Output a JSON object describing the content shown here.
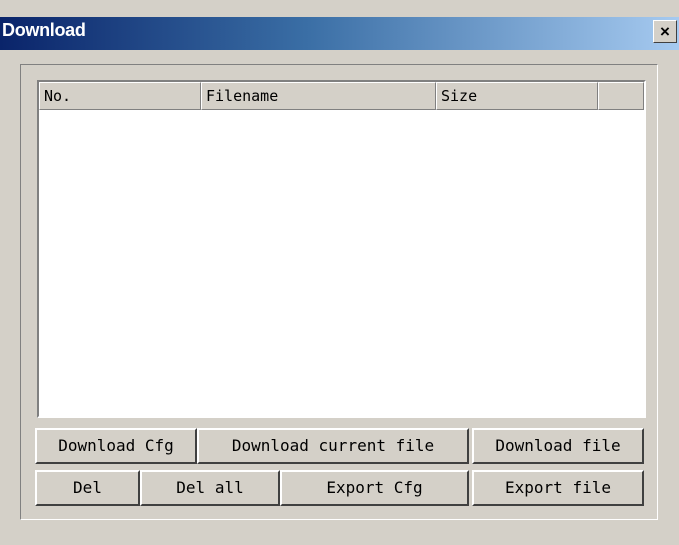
{
  "window": {
    "title": "Download",
    "close_glyph": "✕"
  },
  "list": {
    "columns": [
      "No.",
      "Filename",
      "Size"
    ],
    "rows": []
  },
  "buttons": {
    "download_cfg": "Download Cfg",
    "download_current_file": "Download current file",
    "download_file": "Download file",
    "del": "Del",
    "del_all": "Del all",
    "export_cfg": "Export Cfg",
    "export_file": "Export file"
  },
  "colors": {
    "title_gradient_start": "#0a246a",
    "title_gradient_end": "#a6caf0",
    "face": "#d4d0c8"
  }
}
